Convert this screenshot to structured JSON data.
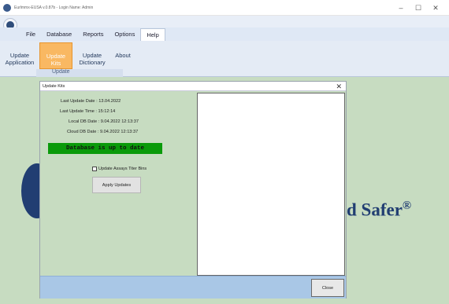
{
  "window": {
    "title": "Eurlmmx-EUSA v.0.87b - Login Name: Admin",
    "controls": [
      "–",
      "☐",
      "✕"
    ]
  },
  "menu": {
    "tabs": [
      "File",
      "Database",
      "Reports",
      "Options",
      "Help"
    ],
    "active": "Help"
  },
  "ribbon": {
    "buttons": [
      {
        "label_1": "Update",
        "label_2": "Application"
      },
      {
        "label_1": "Update",
        "label_2": "Kits"
      },
      {
        "label_1": "Update",
        "label_2": "Dictionary"
      },
      {
        "label_1": "About",
        "label_2": ""
      }
    ],
    "group_label": "Update"
  },
  "background": {
    "slogan": "d Safer",
    "slogan_mark": "®"
  },
  "dialog": {
    "title": "Update Kits",
    "close_glyph": "✕",
    "fields": [
      {
        "label": "Last Update Date :",
        "value": "13.04.2022"
      },
      {
        "label": "Last Update Time :",
        "value": "15:12:14"
      },
      {
        "label": "Local DB Date :",
        "value": "9.04.2022 12:13:37"
      },
      {
        "label": "Cloud DB Date :",
        "value": "9.04.2022 12:13:37"
      }
    ],
    "status_text": "Database is up to date",
    "status_color": "#0a9a0a",
    "checkbox_label": "Update Assays Titer Bins",
    "checkbox_checked": false,
    "apply_button": "Apply Updates",
    "close_button": "Close"
  },
  "colors": {
    "background": "#c7dcc1",
    "ribbon_selected": "#f9b862",
    "footer": "#a9c7e6",
    "brand_navy": "#213e72"
  }
}
